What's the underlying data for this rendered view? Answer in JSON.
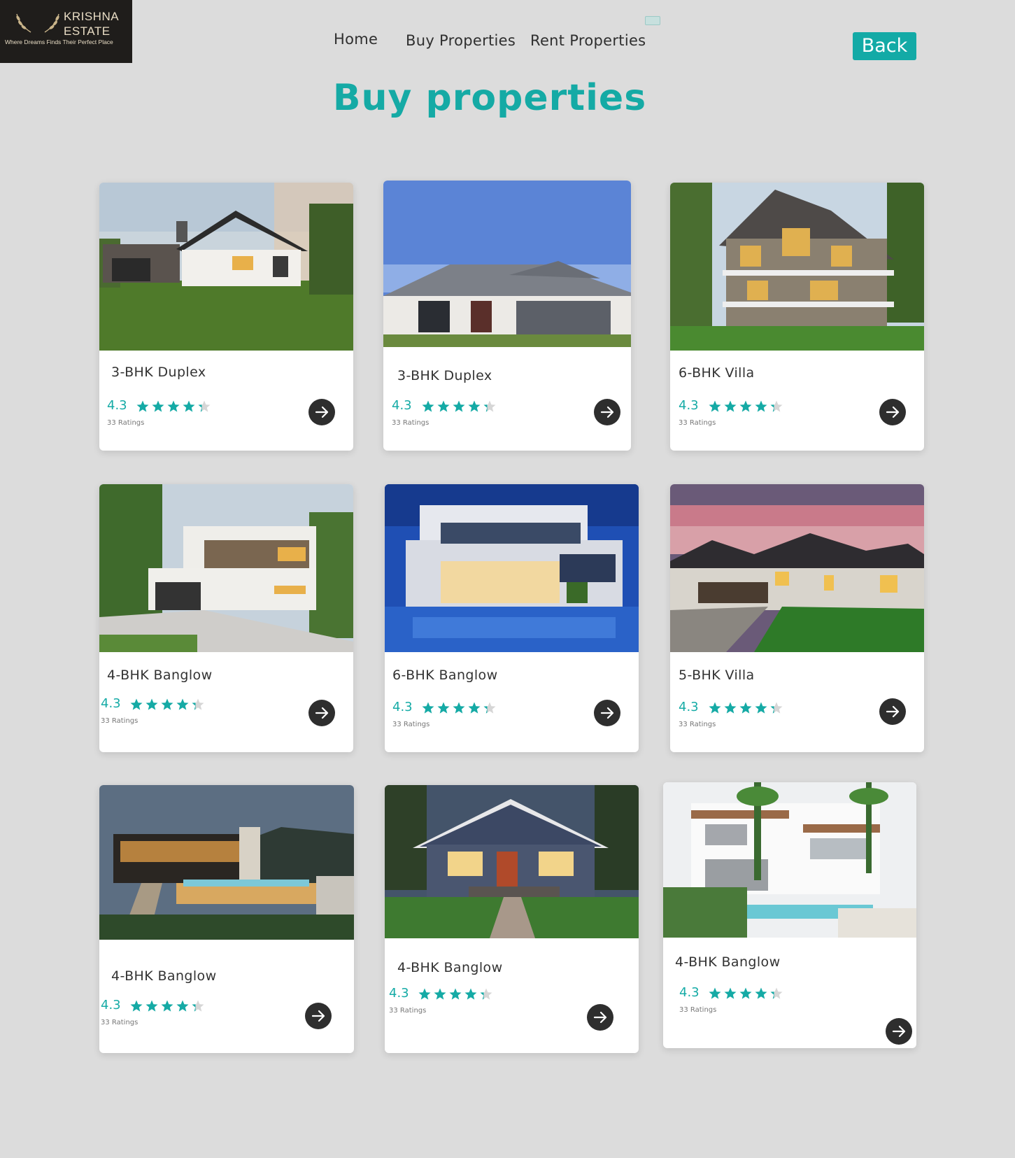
{
  "logo": {
    "line1": "KRISHNA",
    "line2": "ESTATE",
    "tagline": "Where Dreams Finds Their Perfect Place"
  },
  "nav": {
    "home": "Home",
    "buy": "Buy Properties",
    "rent": "Rent Properties"
  },
  "back_label": "Back",
  "page_title": "Buy properties",
  "colors": {
    "accent": "#15aaa5",
    "background": "#dcdcdc",
    "arrow_button": "#2e2e2e",
    "card": "#ffffff"
  },
  "properties": [
    {
      "name": "3-BHK Duplex",
      "rating": "4.3",
      "stars": 4.3,
      "ratings_count": "33 Ratings",
      "image": "house-white-gable-lawn"
    },
    {
      "name": "3-BHK Duplex",
      "rating": "4.3",
      "stars": 4.3,
      "ratings_count": "33 Ratings",
      "image": "house-grey-roof-blue-sky"
    },
    {
      "name": "6-BHK Villa",
      "rating": "4.3",
      "stars": 4.3,
      "ratings_count": "33 Ratings",
      "image": "villa-victorian-porch"
    },
    {
      "name": "4-BHK Banglow",
      "rating": "4.3",
      "stars": 4.3,
      "ratings_count": "33 Ratings",
      "image": "bungalow-modern-white-trees"
    },
    {
      "name": "6-BHK Banglow",
      "rating": "4.3",
      "stars": 4.3,
      "ratings_count": "33 Ratings",
      "image": "bungalow-modern-pool-night"
    },
    {
      "name": "5-BHK Villa",
      "rating": "4.3",
      "stars": 4.3,
      "ratings_count": "33 Ratings",
      "image": "villa-dusk-pink-sky"
    },
    {
      "name": "4-BHK Banglow",
      "rating": "4.3",
      "stars": 4.3,
      "ratings_count": "33 Ratings",
      "image": "bungalow-hillside-pool-evening"
    },
    {
      "name": "4-BHK Banglow",
      "rating": "4.3",
      "stars": 4.3,
      "ratings_count": "33 Ratings",
      "image": "bungalow-craftsman-blue"
    },
    {
      "name": "4-BHK Banglow",
      "rating": "4.3",
      "stars": 4.3,
      "ratings_count": "33 Ratings",
      "image": "bungalow-white-palms-pool"
    }
  ]
}
